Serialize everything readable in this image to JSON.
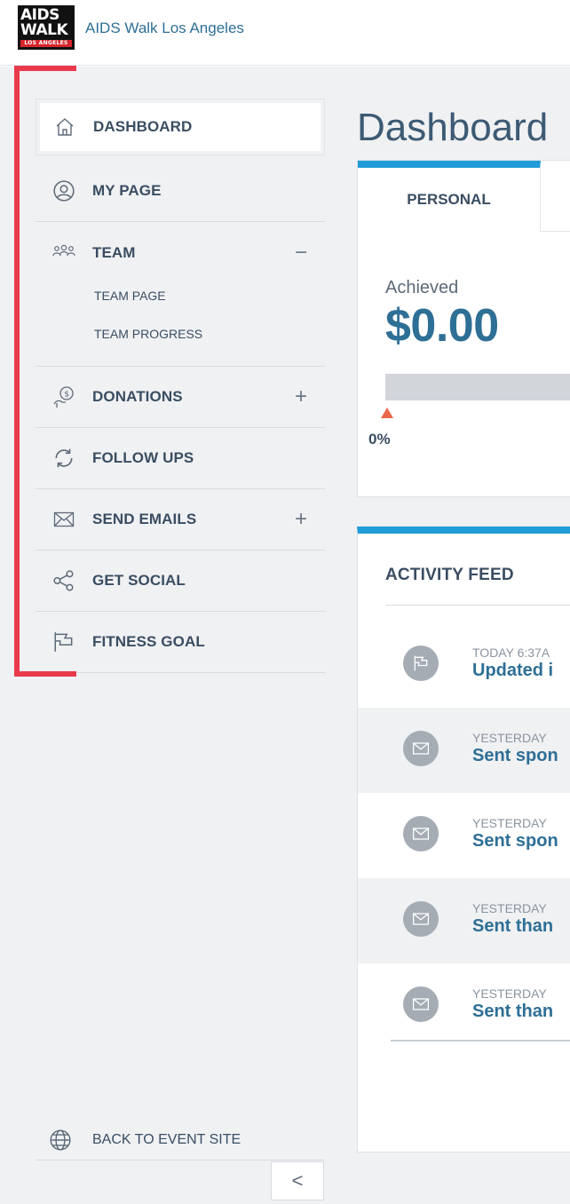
{
  "header": {
    "logo": {
      "line1": "AIDS",
      "line2": "WALK",
      "line3": "LOS ANGELES"
    },
    "brand_name": "AIDS Walk Los Angeles"
  },
  "sidebar": {
    "items": [
      {
        "label": "DASHBOARD",
        "icon": "home-icon",
        "active": true
      },
      {
        "label": "MY PAGE",
        "icon": "user-circle-icon"
      },
      {
        "label": "TEAM",
        "icon": "team-icon",
        "toggle": "−",
        "expanded": true,
        "subitems": [
          {
            "label": "TEAM PAGE"
          },
          {
            "label": "TEAM PROGRESS"
          }
        ]
      },
      {
        "label": "DONATIONS",
        "icon": "donation-icon",
        "toggle": "+"
      },
      {
        "label": "FOLLOW UPS",
        "icon": "refresh-icon"
      },
      {
        "label": "SEND EMAILS",
        "icon": "envelope-icon",
        "toggle": "+"
      },
      {
        "label": "GET SOCIAL",
        "icon": "share-icon"
      },
      {
        "label": "FITNESS GOAL",
        "icon": "flag-icon"
      }
    ],
    "back_link": {
      "label": "BACK TO EVENT SITE",
      "icon": "globe-icon"
    },
    "collapse": {
      "label": "<",
      "icon": "chevron-left-icon"
    },
    "highlight_color": "#e83a4c"
  },
  "main": {
    "title": "Dashboard",
    "tabs": [
      {
        "label": "PERSONAL",
        "active": true
      }
    ],
    "achieved": {
      "label": "Achieved",
      "value": "$0.00",
      "progress_percent": 0,
      "progress_label": "0%"
    },
    "feed": {
      "title": "ACTIVITY FEED",
      "items": [
        {
          "time": "TODAY 6:37A",
          "text": "Updated i",
          "icon": "flag-icon"
        },
        {
          "time": "YESTERDAY",
          "text": "Sent spon",
          "icon": "envelope-icon"
        },
        {
          "time": "YESTERDAY",
          "text": "Sent spon",
          "icon": "envelope-icon"
        },
        {
          "time": "YESTERDAY",
          "text": "Sent than",
          "icon": "envelope-icon"
        },
        {
          "time": "YESTERDAY",
          "text": "Sent than",
          "icon": "envelope-icon"
        }
      ]
    }
  },
  "colors": {
    "accent": "#1f9bd7",
    "text_blue": "#2e6f96",
    "marker": "#e8674a"
  }
}
